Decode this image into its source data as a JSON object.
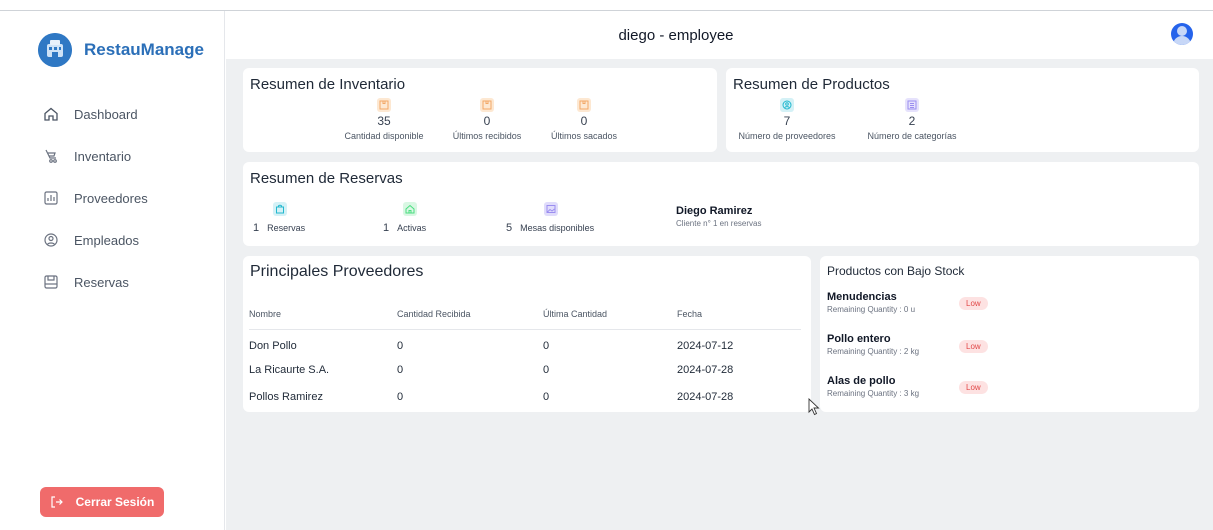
{
  "app": {
    "brand": "RestauManage"
  },
  "sidebar": {
    "items": [
      {
        "label": "Dashboard",
        "icon": "home-icon"
      },
      {
        "label": "Inventario",
        "icon": "inventory-icon"
      },
      {
        "label": "Proveedores",
        "icon": "chart-icon"
      },
      {
        "label": "Empleados",
        "icon": "user-icon"
      },
      {
        "label": "Reservas",
        "icon": "reservations-icon"
      }
    ],
    "logout_label": "Cerrar Sesión"
  },
  "header": {
    "title": "diego - employee"
  },
  "inventory_summary": {
    "title": "Resumen de Inventario",
    "stats": [
      {
        "value": "35",
        "caption": "Cantidad disponible"
      },
      {
        "value": "0",
        "caption": "Últimos recibidos"
      },
      {
        "value": "0",
        "caption": "Últimos sacados"
      }
    ]
  },
  "product_summary": {
    "title": "Resumen de Productos",
    "stats": [
      {
        "value": "7",
        "caption": "Número de proveedores"
      },
      {
        "value": "2",
        "caption": "Número de categorías"
      }
    ]
  },
  "reservation_summary": {
    "title": "Resumen de Reservas",
    "stats": [
      {
        "value": "1",
        "caption": "Reservas"
      },
      {
        "value": "1",
        "caption": "Activas"
      },
      {
        "value": "5",
        "caption": "Mesas disponibles"
      }
    ],
    "top_client": {
      "name": "Diego Ramirez",
      "note": "Cliente n° 1 en reservas"
    }
  },
  "suppliers": {
    "title": "Principales Proveedores",
    "columns": [
      "Nombre",
      "Cantidad Recibida",
      "Última Cantidad",
      "Fecha"
    ],
    "rows": [
      [
        "Don Pollo",
        "0",
        "0",
        "2024-07-12"
      ],
      [
        "La Ricaurte S.A.",
        "0",
        "0",
        "2024-07-28"
      ],
      [
        "Pollos Ramirez",
        "0",
        "0",
        "2024-07-28"
      ]
    ]
  },
  "low_stock": {
    "title": "Productos con Bajo Stock",
    "items": [
      {
        "name": "Menudencias",
        "remaining": "Remaining Quantity : 0 u",
        "badge": "Low"
      },
      {
        "name": "Pollo entero",
        "remaining": "Remaining Quantity : 2 kg",
        "badge": "Low"
      },
      {
        "name": "Alas de pollo",
        "remaining": "Remaining Quantity : 3 kg",
        "badge": "Low"
      }
    ]
  },
  "colors": {
    "brand": "#2b6fb8",
    "logout": "#f06b6b",
    "box_orange": "#f2a766",
    "teal": "#22b8cf",
    "purple": "#9b8ef0",
    "green": "#4ade80",
    "low_badge": "#e14848"
  }
}
